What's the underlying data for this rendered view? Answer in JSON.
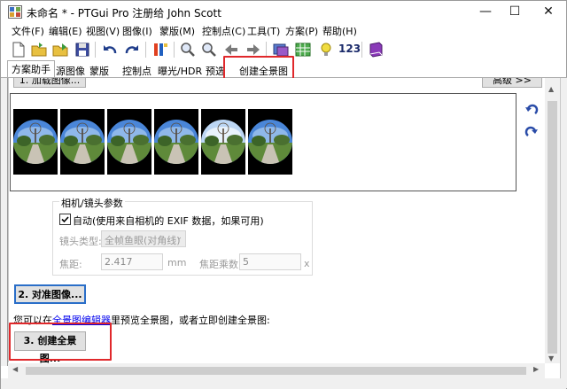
{
  "window": {
    "title": "未命名 * - PTGui Pro 注册给 John Scott",
    "minimize": "—",
    "maximize": "☐",
    "close": "✕"
  },
  "menu": [
    {
      "label": "文件(F)"
    },
    {
      "label": "编辑(E)"
    },
    {
      "label": "视图(V)"
    },
    {
      "label": "图像(I)"
    },
    {
      "label": "蒙版(M)"
    },
    {
      "label": "控制点(C)"
    },
    {
      "label": "工具(T)"
    },
    {
      "label": "方案(P)"
    },
    {
      "label": "帮助(H)"
    }
  ],
  "toolbar": {
    "icons": [
      "new-file-icon",
      "open-folder-icon",
      "open-recent-icon",
      "save-icon",
      "undo-icon",
      "redo-icon",
      "tools-icon",
      "zoom-in-icon",
      "zoom-out-icon",
      "arrow-left-icon",
      "arrow-right-icon",
      "panorama-editor-icon",
      "table-icon",
      "lightbulb-icon",
      "book-icon"
    ],
    "counter_label": "123"
  },
  "tabs": [
    {
      "label": "方案助手"
    },
    {
      "label": "源图像"
    },
    {
      "label": "蒙版"
    },
    {
      "label": "控制点"
    },
    {
      "label": "曝光/HDR"
    },
    {
      "label": "预选"
    },
    {
      "label": "创建全景图"
    }
  ],
  "content": {
    "load_button": "1. 加载图像...",
    "browse_button": "高级 >>",
    "thumbnails_count": 6,
    "lens_group": {
      "title": "相机/镜头参数",
      "auto_checkbox": "自动(使用来自相机的 EXIF 数据，如果可用)",
      "auto_checked": true,
      "lens_type_label": "镜头类型:",
      "lens_type_value": "全帧鱼眼(对角线)",
      "focal_label": "焦距:",
      "focal_value": "2.417",
      "focal_unit": "mm",
      "multiplier_label": "焦距乘数:",
      "multiplier_value": "5",
      "multiplier_unit": "x"
    },
    "align_button": "2. 对准图像...",
    "info_prefix": "您可以在",
    "info_link": "全景图编辑器",
    "info_suffix": "里预览全景图，或者立即创建全景图:",
    "create_button": "3. 创建全景图..."
  },
  "colors": {
    "highlight": "#e0282b",
    "link": "#0000ee",
    "sky": "#4a86d8"
  }
}
